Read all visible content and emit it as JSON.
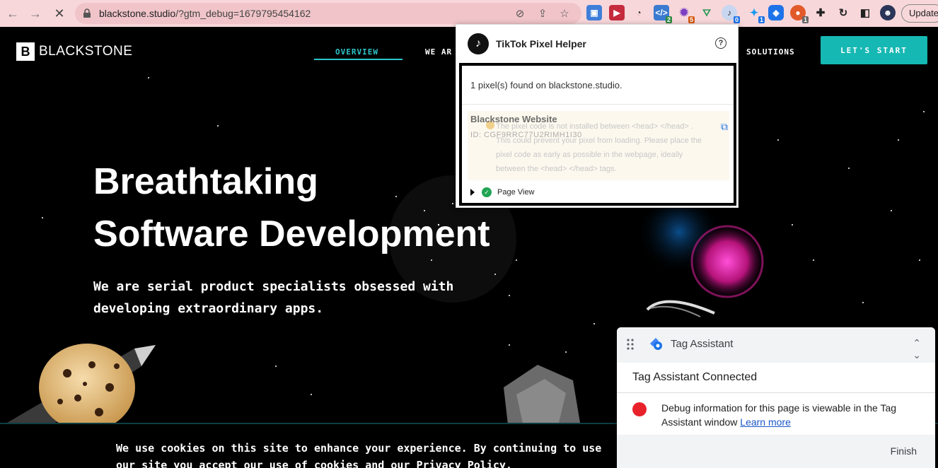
{
  "browser": {
    "url_host": "blackstone.studio",
    "url_path": "/?gtm_debug=1679795454162",
    "update_label": "Update",
    "extension_badges": [
      "2",
      "5",
      "0",
      "1",
      "1"
    ]
  },
  "site": {
    "logo_mark": "B",
    "logo_text": "BLACKSTONE",
    "nav": [
      "OVERVIEW",
      "WE AR",
      "SOLUTIONS"
    ],
    "cta": "LET'S START",
    "hero_title_line1": "Breathtaking",
    "hero_title_line2": "Software Development",
    "hero_sub": "We are serial product specialists obsessed with developing extraordinary apps.",
    "cookie_text": "We use cookies on this site to enhance your experience. By continuing to use our site you accept our use of cookies and our Privacy Policy."
  },
  "tiktok": {
    "title": "TikTok Pixel Helper",
    "help": "?",
    "found_text": "1 pixel(s) found on blackstone.studio.",
    "warning_text": "The pixel code is not installed between <head> </head> . This could prevent your pixel from loading. Please place the pixel code as early as possible in the webpage, ideally between the <head> </head> tags.",
    "pixel_name": "Blackstone Website",
    "pixel_id": "ID:  CGF9RRC77U2RIMH1I30",
    "event": "Page View"
  },
  "tag_assistant": {
    "title": "Tag Assistant",
    "connected": "Tag Assistant Connected",
    "message": "Debug information for this page is viewable in the Tag Assistant window",
    "learn_more": "Learn more",
    "finish": "Finish"
  },
  "colors": {
    "accent": "#16b8b3",
    "chrome_bg": "#f8d7da",
    "ta_error": "#e8222b"
  }
}
